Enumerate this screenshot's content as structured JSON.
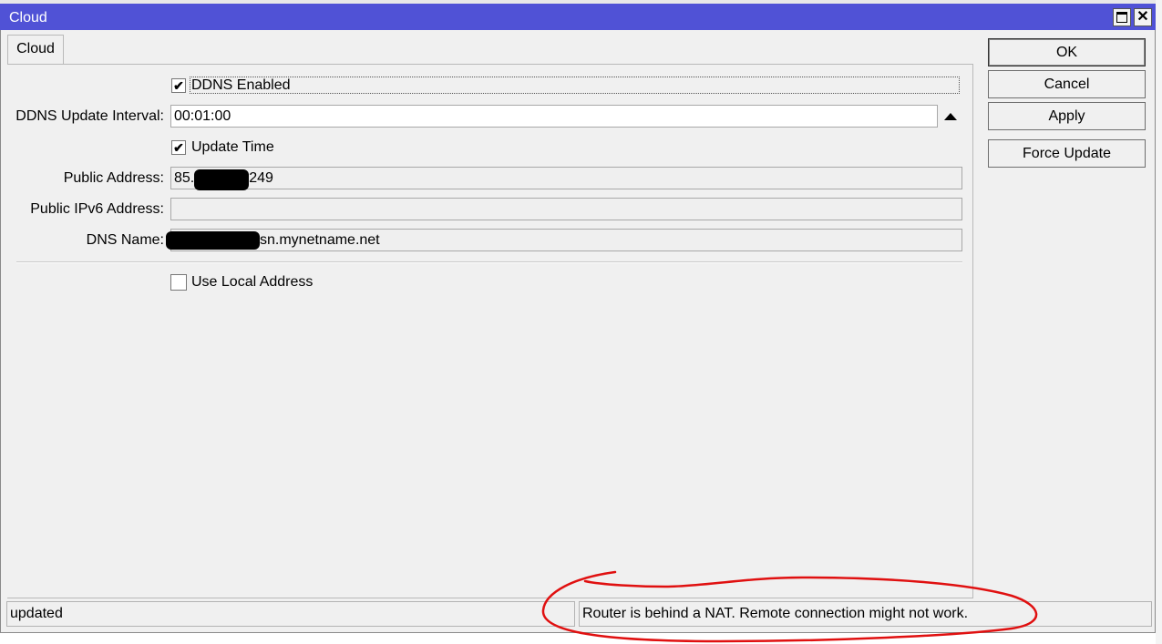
{
  "window": {
    "title": "Cloud",
    "maximize_icon": "maximize-icon",
    "close_icon": "close-icon",
    "close_glyph": "✕"
  },
  "tabs": [
    {
      "label": "Cloud",
      "active": true
    }
  ],
  "form": {
    "ddns_enabled": {
      "label": "DDNS Enabled",
      "checked": true
    },
    "ddns_update_interval": {
      "label": "DDNS Update Interval:",
      "value": "00:01:00"
    },
    "update_time": {
      "label": "Update Time",
      "checked": true
    },
    "public_address": {
      "label": "Public Address:",
      "value_prefix": "85.",
      "value_suffix": "249"
    },
    "public_ipv6_address": {
      "label": "Public IPv6 Address:",
      "value": ""
    },
    "dns_name": {
      "label": "DNS Name:",
      "value_suffix": "sn.mynetname.net"
    },
    "use_local_address": {
      "label": "Use Local Address",
      "checked": false
    }
  },
  "buttons": {
    "ok": "OK",
    "cancel": "Cancel",
    "apply": "Apply",
    "force_update": "Force Update"
  },
  "status": {
    "left": "updated",
    "right": "Router is behind a NAT. Remote connection might not work."
  },
  "colors": {
    "titlebar": "#5052d6",
    "annotation": "#e01010"
  },
  "checkmark_glyph": "✔"
}
